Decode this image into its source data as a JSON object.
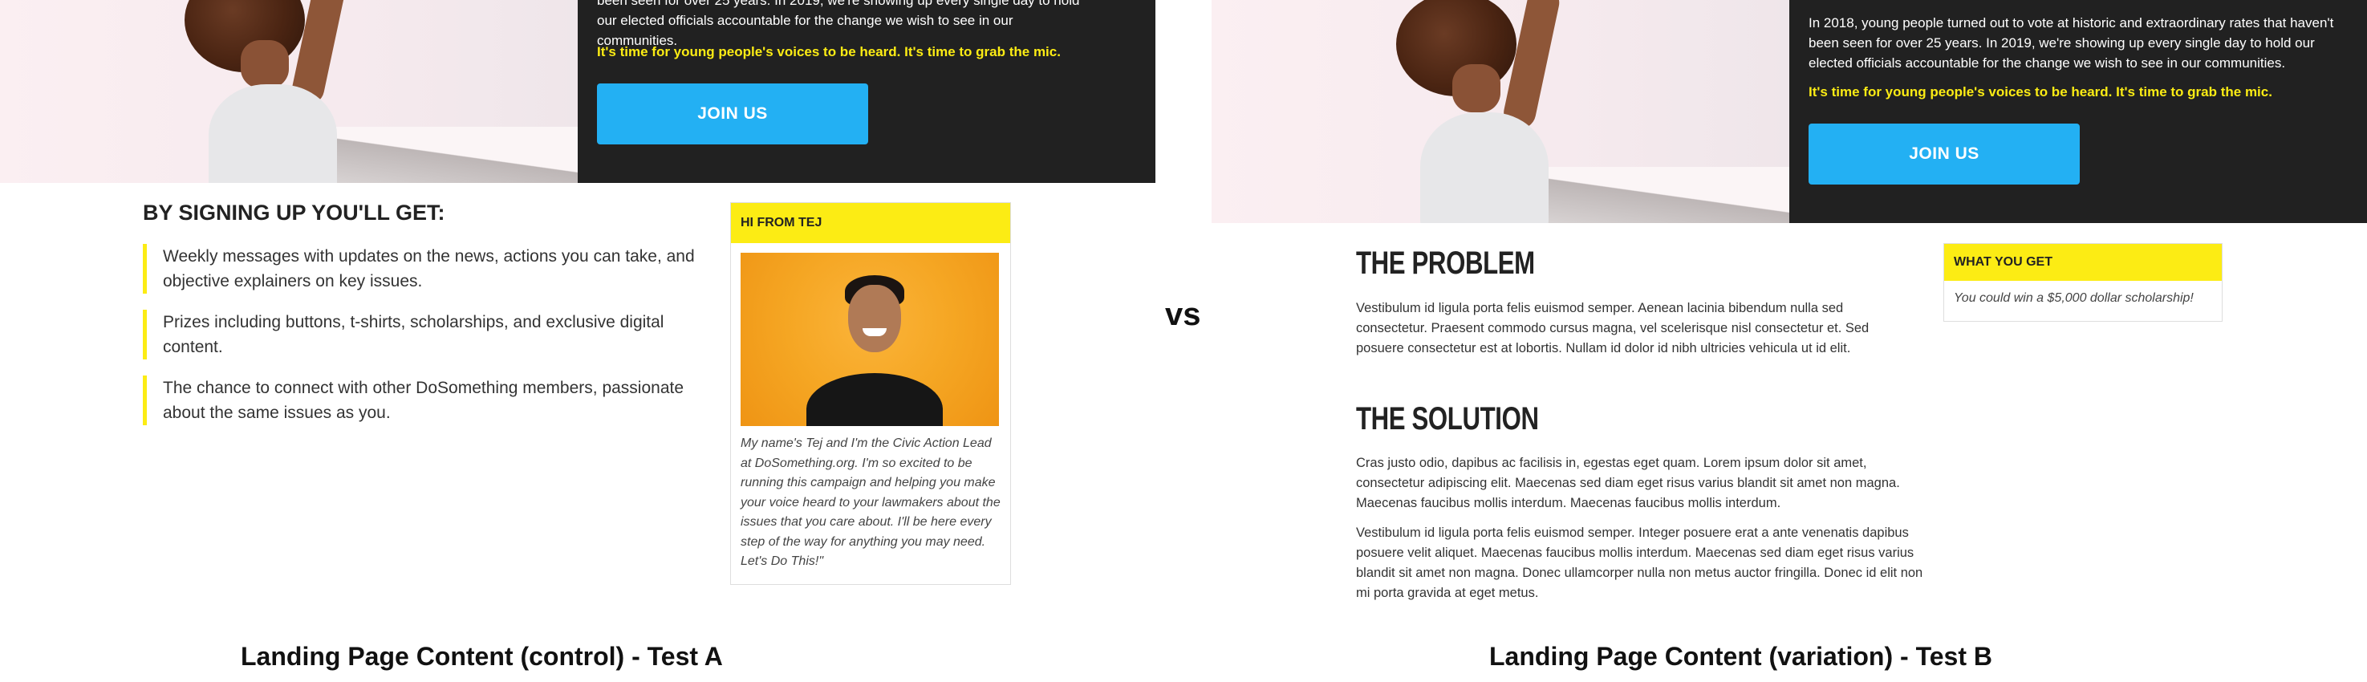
{
  "control": {
    "hero_text_partial": "been seen for over 25 years. In 2019, we're showing up every single day to hold our elected officials accountable for the change we wish to see in our communities.",
    "hero_cta": "It's time for young people's voices to be heard. It's time to grab the mic.",
    "join_label": "JOIN US",
    "benefits_title": "BY SIGNING UP YOU'LL GET:",
    "benefits": [
      "Weekly messages with updates on the news, actions you can take, and objective explainers on key issues.",
      "Prizes including buttons, t-shirts, scholarships, and exclusive digital content.",
      "The chance to connect with other DoSomething members, passionate about the same issues as you."
    ],
    "card_title": "HI FROM TEJ",
    "card_text": "My name's Tej and I'm the Civic Action Lead at DoSomething.org. I'm so excited to be running this campaign and helping you make your voice heard to your lawmakers about the issues that you care about. I'll be here every step of the way for anything you may need. Let's Do This!\""
  },
  "vs_label": "vs",
  "variation": {
    "hero_text": "In 2018, young people turned out to vote at historic and extraordinary rates that haven't been seen for over 25 years. In 2019, we're showing up every single day to hold our elected officials accountable for the change we wish to see in our communities.",
    "hero_cta": "It's time for young people's voices to be heard. It's time to grab the mic.",
    "join_label": "JOIN US",
    "problem_title": "THE PROBLEM",
    "problem_text": "Vestibulum id ligula porta felis euismod semper. Aenean lacinia bibendum nulla sed consectetur. Praesent commodo cursus magna, vel scelerisque nisl consectetur et. Sed posuere consectetur est at lobortis. Nullam id dolor id nibh ultricies vehicula ut id elit.",
    "solution_title": "THE SOLUTION",
    "solution_text_1": "Cras justo odio, dapibus ac facilisis in, egestas eget quam. Lorem ipsum dolor sit amet, consectetur adipiscing elit. Maecenas sed diam eget risus varius blandit sit amet non magna. Maecenas faucibus mollis interdum. Maecenas faucibus mollis interdum.",
    "solution_text_2": "Vestibulum id ligula porta felis euismod semper. Integer posuere erat a ante venenatis dapibus posuere velit aliquet. Maecenas faucibus mollis interdum. Maecenas sed diam eget risus varius blandit sit amet non magna. Donec ullamcorper nulla non metus auctor fringilla. Donec id elit non mi porta gravida at eget metus.",
    "card_title": "WHAT YOU GET",
    "card_text": "You could win a $5,000 dollar scholarship!"
  },
  "captions": {
    "control": "Landing Page Content (control) - Test A",
    "variation": "Landing Page Content (variation) - Test B"
  },
  "colors": {
    "accent_yellow": "#fcec14",
    "button_blue": "#23b0f3",
    "dark_bg": "#212121"
  }
}
